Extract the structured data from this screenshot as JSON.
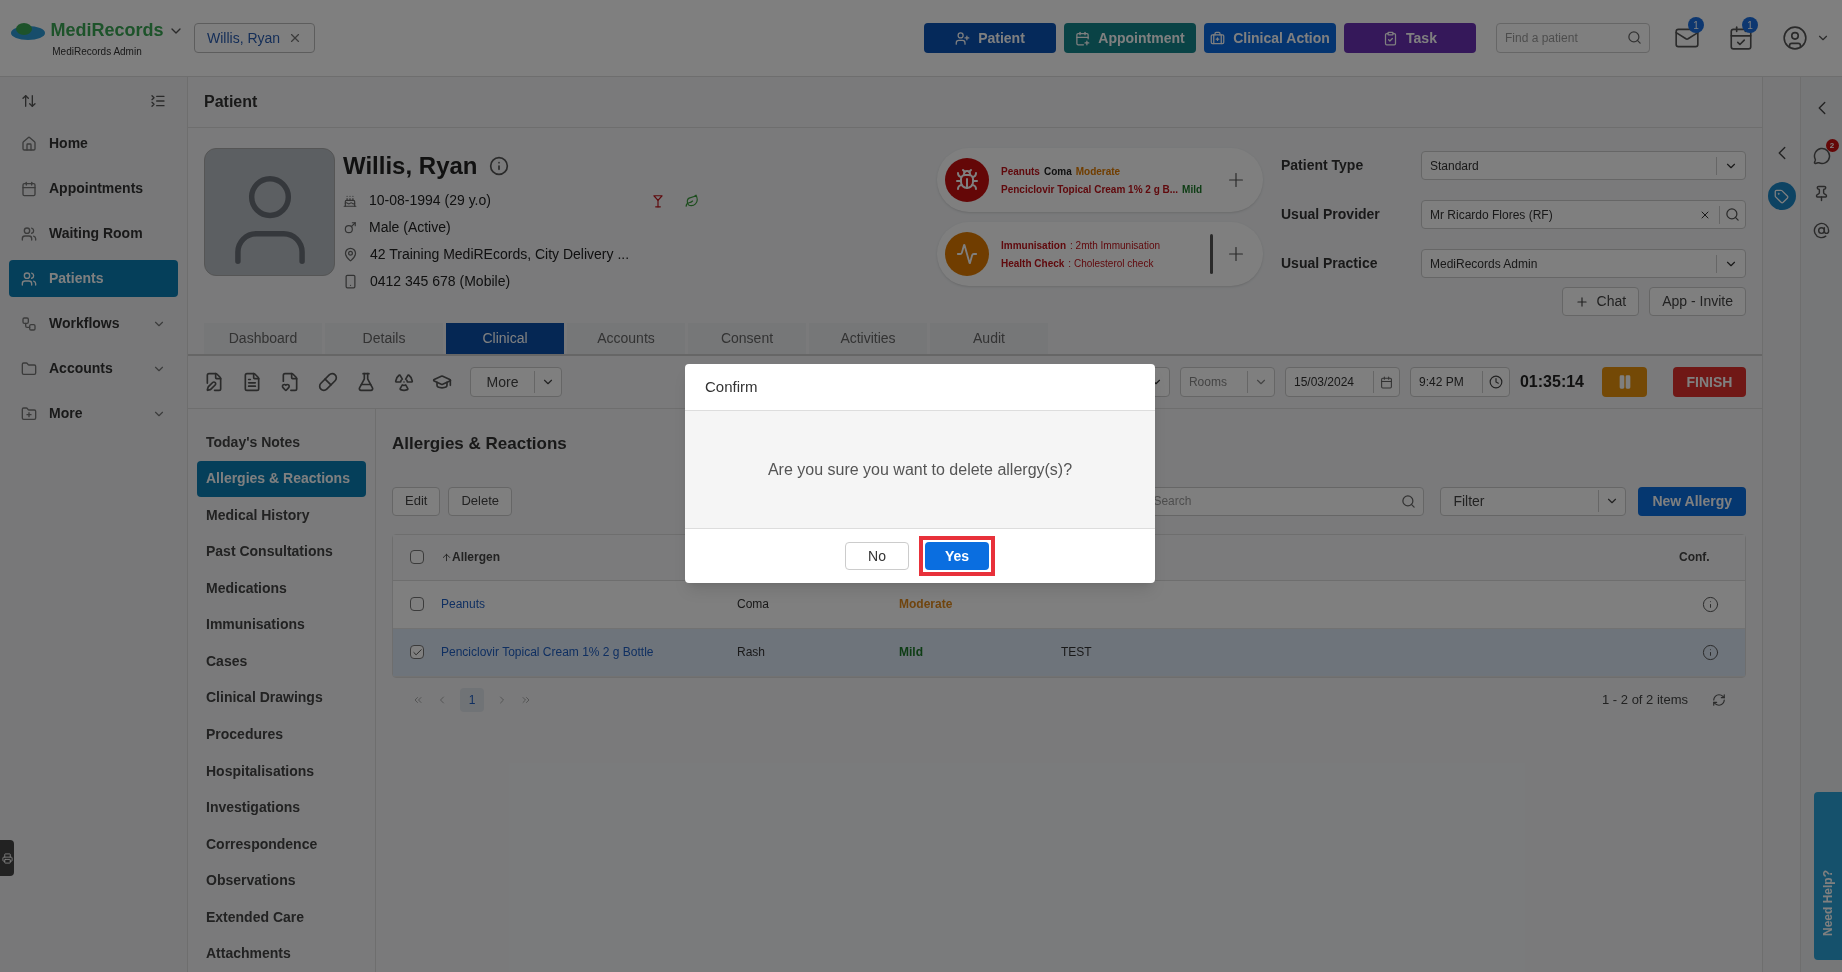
{
  "brand": {
    "name": "MediRecords",
    "subtitle": "MediRecords Admin"
  },
  "open_patient_tab": "Willis, Ryan",
  "header_actions": [
    {
      "label": "Patient",
      "kind": "patient"
    },
    {
      "label": "Appointment",
      "kind": "appointment"
    },
    {
      "label": "Clinical Action",
      "kind": "clinical"
    },
    {
      "label": "Task",
      "kind": "task"
    }
  ],
  "patient_search": {
    "placeholder": "Find a patient"
  },
  "mail_badge": "1",
  "calendar_badge": "1",
  "nav": [
    {
      "label": "Home",
      "selected": false,
      "expandable": false
    },
    {
      "label": "Appointments",
      "selected": false,
      "expandable": false
    },
    {
      "label": "Waiting Room",
      "selected": false,
      "expandable": false
    },
    {
      "label": "Patients",
      "selected": true,
      "expandable": false
    },
    {
      "label": "Workflows",
      "selected": false,
      "expandable": true
    },
    {
      "label": "Accounts",
      "selected": false,
      "expandable": true
    },
    {
      "label": "More",
      "selected": false,
      "expandable": true
    }
  ],
  "page_title": "Patient",
  "patient": {
    "name": "Willis, Ryan",
    "dob": "10-08-1994 (29 y.o)",
    "gender": "Male (Active)",
    "address": "42 Training MediREcords, City Delivery ...",
    "phone": "0412 345 678 (Mobile)"
  },
  "alerts": [
    {
      "kind": "allergy",
      "lines": [
        [
          {
            "text": "Peanuts",
            "kind": "allergen"
          },
          {
            "text": "Coma",
            "kind": "reaction"
          },
          {
            "text": "Moderate",
            "kind": "moderate"
          }
        ],
        [
          {
            "text": "Penciclovir Topical Cream 1% 2 g B...",
            "kind": "allergen"
          },
          {
            "text": "Mild",
            "kind": "mild"
          }
        ]
      ]
    },
    {
      "kind": "reminder",
      "lines": [
        [
          {
            "text": "Immunisation",
            "kind": "label"
          },
          {
            "text": ": 2mth Immunisation",
            "kind": "detail"
          }
        ],
        [
          {
            "text": "Health Check",
            "kind": "label"
          },
          {
            "text": ": Cholesterol check",
            "kind": "detail"
          }
        ]
      ]
    }
  ],
  "patient_fields": [
    {
      "label": "Patient Type",
      "value": "Standard",
      "kind": "select"
    },
    {
      "label": "Usual Provider",
      "value": "Mr Ricardo Flores (RF)",
      "kind": "lookup"
    },
    {
      "label": "Usual Practice",
      "value": "MediRecords Admin",
      "kind": "select"
    }
  ],
  "side_buttons": [
    "Chat",
    "App - Invite"
  ],
  "tabs": [
    {
      "label": "Dashboard",
      "selected": false
    },
    {
      "label": "Details",
      "selected": false
    },
    {
      "label": "Clinical",
      "selected": true
    },
    {
      "label": "Accounts",
      "selected": false
    },
    {
      "label": "Consent",
      "selected": false
    },
    {
      "label": "Activities",
      "selected": false
    },
    {
      "label": "Audit",
      "selected": false
    }
  ],
  "toolbar": {
    "more": "More",
    "rooms": "Rooms",
    "date": "15/03/2024",
    "time": "9:42 PM",
    "timer": "01:35:14",
    "finish": "FINISH"
  },
  "clinical_menu": [
    {
      "label": "Today's Notes",
      "selected": false
    },
    {
      "label": "Allergies & Reactions",
      "selected": true
    },
    {
      "label": "Medical History",
      "selected": false
    },
    {
      "label": "Past Consultations",
      "selected": false
    },
    {
      "label": "Medications",
      "selected": false
    },
    {
      "label": "Immunisations",
      "selected": false
    },
    {
      "label": "Cases",
      "selected": false
    },
    {
      "label": "Clinical Drawings",
      "selected": false
    },
    {
      "label": "Procedures",
      "selected": false
    },
    {
      "label": "Hospitalisations",
      "selected": false
    },
    {
      "label": "Investigations",
      "selected": false
    },
    {
      "label": "Correspondence",
      "selected": false
    },
    {
      "label": "Observations",
      "selected": false
    },
    {
      "label": "Extended Care",
      "selected": false
    },
    {
      "label": "Attachments",
      "selected": false
    }
  ],
  "section_title": "Allergies & Reactions",
  "actions": [
    "Edit",
    "Delete"
  ],
  "search": {
    "placeholder": "Search"
  },
  "filter": "Filter",
  "new_button": "New Allergy",
  "table": {
    "columns": [
      "Allergen",
      "Conf."
    ],
    "select_all": {
      "checked": false
    },
    "rows": [
      {
        "allergen": "Peanuts",
        "reaction": "Coma",
        "severity": {
          "label": "Moderate",
          "kind": "moderate"
        },
        "checked": false,
        "selected": false
      },
      {
        "allergen": "Penciclovir Topical Cream 1% 2 g Bottle",
        "reaction": "Rash",
        "severity": {
          "label": "Mild",
          "kind": "mild"
        },
        "comment": "TEST",
        "checked": true,
        "selected": true
      }
    ]
  },
  "pagination": {
    "pages": [
      {
        "label": "1",
        "selected": true
      }
    ],
    "summary": "1 - 2 of 2 items"
  },
  "right_badge": "2",
  "help_tab": "Need Help?",
  "dialog": {
    "title": "Confirm",
    "message": "Are you sure you want to delete allergy(s)?",
    "buttons": [
      {
        "label": "No",
        "primary": false,
        "highlighted": false
      },
      {
        "label": "Yes",
        "primary": true,
        "highlighted": true
      }
    ]
  }
}
